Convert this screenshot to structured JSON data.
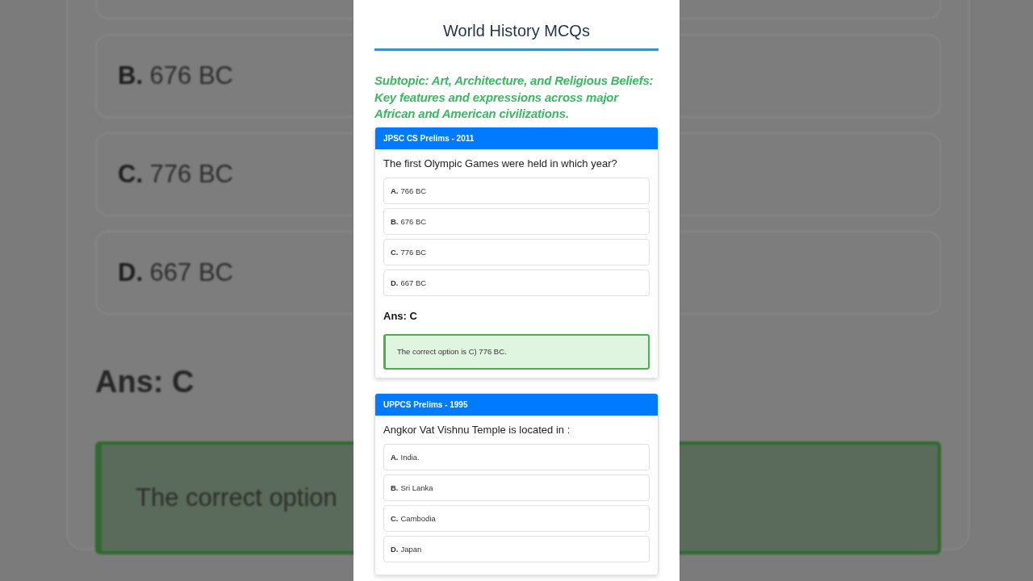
{
  "backdrop": {
    "options": [
      {
        "letter": "B.",
        "text": "676 BC"
      },
      {
        "letter": "C.",
        "text": "776 BC"
      },
      {
        "letter": "D.",
        "text": "667 BC"
      }
    ],
    "answer": "Ans: C",
    "explanation": "The correct option"
  },
  "page": {
    "title": "World History MCQs",
    "subtopic": "Subtopic: Art, Architecture, and Religious Beliefs: Key features and expressions across major African and American civilizations.",
    "questions": [
      {
        "source": "JPSC CS Prelims - 2011",
        "question": "The first Olympic Games were held in which year?",
        "options": [
          {
            "letter": "A.",
            "text": "766 BC"
          },
          {
            "letter": "B.",
            "text": "676 BC"
          },
          {
            "letter": "C.",
            "text": "776 BC"
          },
          {
            "letter": "D.",
            "text": "667 BC"
          }
        ],
        "answer": "Ans: C",
        "explanation": "The correct option is C) 776 BC."
      },
      {
        "source": "UPPCS Prelims - 1995",
        "question": "Angkor Vat Vishnu Temple is located in :",
        "options": [
          {
            "letter": "A.",
            "text": "India."
          },
          {
            "letter": "B.",
            "text": "Sri Lanka"
          },
          {
            "letter": "C.",
            "text": "Cambodia"
          },
          {
            "letter": "D.",
            "text": "Japan"
          }
        ]
      }
    ]
  }
}
